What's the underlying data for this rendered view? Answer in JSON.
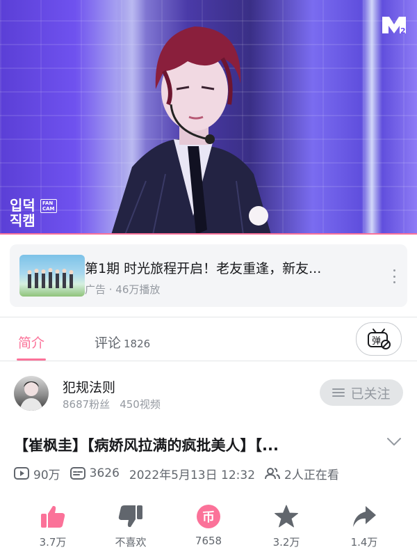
{
  "player": {
    "fancam_logo_line1": "입덕",
    "fancam_logo_line2": "직캠",
    "fancam_tag": "FAN CAM",
    "channel_logo": "M2"
  },
  "ad": {
    "title": "第1期 时光旅程开启！老友重逢，新友...",
    "meta": "广告 · 46万播放"
  },
  "tabs": {
    "intro_label": "简介",
    "comments_label": "评论",
    "comments_count": "1826",
    "danmaku_icon": "danmaku-toggle-icon"
  },
  "uploader": {
    "name": "犯规法则",
    "followers": "8687粉丝",
    "videos": "450视频",
    "follow_label": "已关注"
  },
  "video": {
    "title": "【崔枫圭】【病娇风拉满的疯批美人】【...",
    "views": "90万",
    "danmaku": "3626",
    "date": "2022年5月13日 12:32",
    "watching": "2人正在看"
  },
  "actions": {
    "like": "3.7万",
    "dislike": "不喜欢",
    "coin": "7658",
    "coin_glyph": "币",
    "favorite": "3.2万",
    "share": "1.4万"
  },
  "colors": {
    "accent": "#fb7299",
    "text_primary": "#18191c",
    "text_secondary": "#61666d",
    "text_muted": "#9499a0"
  }
}
